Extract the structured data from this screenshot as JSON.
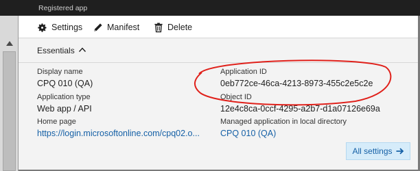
{
  "header": {
    "title_cut": "Registered app",
    "subtitle": "Registered app"
  },
  "toolbar": {
    "settings_label": "Settings",
    "manifest_label": "Manifest",
    "delete_label": "Delete"
  },
  "essentials": {
    "label": "Essentials",
    "fields": {
      "display_name": {
        "label": "Display name",
        "value": "CPQ 010 (QA)"
      },
      "application_type": {
        "label": "Application type",
        "value": "Web app / API"
      },
      "home_page": {
        "label": "Home page",
        "value": "https://login.microsoftonline.com/cpq02.o..."
      },
      "application_id": {
        "label": "Application ID",
        "value": "0eb772ce-46ca-4213-8973-455c2e5c2e"
      },
      "object_id": {
        "label": "Object ID",
        "value": "12e4c8ca-0ccf-4295-a2b7-d1a07126e69a"
      },
      "managed_app": {
        "label": "Managed application in local directory",
        "value": "CPQ 010 (QA)"
      }
    }
  },
  "actions": {
    "all_settings_label": "All settings"
  },
  "colors": {
    "link": "#1560a6",
    "annotation": "#e0201a",
    "button_bg": "#d6ecfa"
  }
}
